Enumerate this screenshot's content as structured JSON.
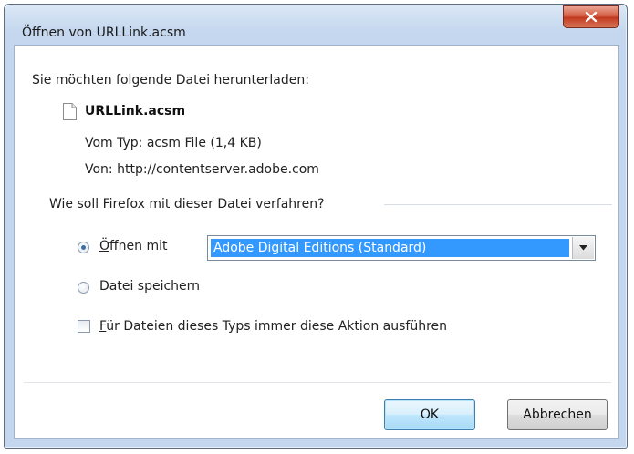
{
  "window": {
    "title": "Öffnen von URLLink.acsm"
  },
  "dialog": {
    "prompt": "Sie möchten folgende Datei herunterladen:",
    "file_name": "URLLink.acsm",
    "file_type": "Vom Typ:  acsm File (1,4 KB)",
    "file_source": "Von:  http://contentserver.adobe.com",
    "question": "Wie soll Firefox mit dieser Datei verfahren?",
    "open_with_mnemonic": "Ö",
    "open_with_rest": "ffnen mit",
    "open_with_app": "Adobe Digital Editions (Standard)",
    "save_file": "Datei speichern",
    "always_mnemonic": "F",
    "always_rest": "ür Dateien dieses Typs immer diese Aktion ausführen",
    "ok_label": "OK",
    "cancel_label": "Abbrechen",
    "open_with_selected": true,
    "always_checked": false
  },
  "icons": {
    "close": "close-icon",
    "file": "file-icon",
    "dropdown": "chevron-down-icon"
  },
  "colors": {
    "selection": "#3399ff",
    "close_button": "#c9452a",
    "frame": "#c4d7ee"
  }
}
